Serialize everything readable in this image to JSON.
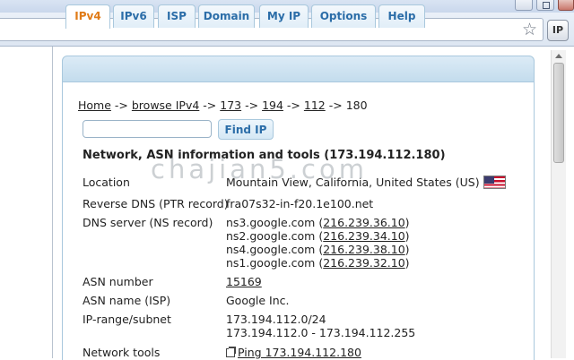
{
  "browser": {
    "extension_button_label": "IP",
    "bookmark_icon": "star-icon",
    "extension_icon": "ip-extension-icon"
  },
  "tabs": [
    {
      "label": "IPv4",
      "active": true
    },
    {
      "label": "IPv6",
      "active": false
    },
    {
      "label": "ISP",
      "active": false
    },
    {
      "label": "Domain",
      "active": false
    },
    {
      "label": "My IP",
      "active": false
    },
    {
      "label": "Options",
      "active": false
    },
    {
      "label": "Help",
      "active": false
    }
  ],
  "breadcrumb": {
    "home": "Home",
    "browse": "browse IPv4",
    "sep": "->",
    "o1": "173",
    "o2": "194",
    "o3": "112",
    "o4": "180"
  },
  "search": {
    "value": "",
    "placeholder": "",
    "button_label": "Find IP"
  },
  "section_title": "Network, ASN information and tools (173.194.112.180)",
  "info": {
    "location_label": "Location",
    "location_value": "Mountain View, California, United States (US)",
    "location_flag": "us-flag-icon",
    "rdns_label": "Reverse DNS (PTR record)",
    "rdns_value": "fra07s32-in-f20.1e100.net",
    "dns_label": "DNS server (NS record)",
    "dns_servers": [
      {
        "host": "ns3.google.com",
        "ip": "216.239.36.10"
      },
      {
        "host": "ns2.google.com",
        "ip": "216.239.34.10"
      },
      {
        "host": "ns4.google.com",
        "ip": "216.239.38.10"
      },
      {
        "host": "ns1.google.com",
        "ip": "216.239.32.10"
      }
    ],
    "asn_label": "ASN number",
    "asn_value": "15169",
    "asn_name_label": "ASN name (ISP)",
    "asn_name_value": "Google Inc.",
    "range_label": "IP-range/subnet",
    "range_cidr": "173.194.112.0/24",
    "range_span": "173.194.112.0 - 173.194.112.255",
    "tools_label": "Network tools",
    "tools_ping": "Ping 173.194.112.180"
  },
  "watermark": "chajian5.com",
  "colors": {
    "tab_text": "#2b6da8",
    "tab_active_text": "#e07b17",
    "tab_border": "#a9c8dd"
  }
}
